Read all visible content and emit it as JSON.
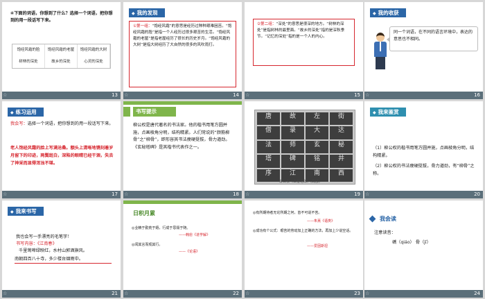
{
  "slides": [
    {
      "num": "13",
      "question": "④下面的词语，你想到了什么？选择一个词语，把你想到的用一段话写下来。",
      "words": [
        "饱经风霜的脸",
        "树林的深处",
        "饱经风霜的老屋",
        "故乡的深处",
        "饱经风霜的大树",
        "心灵的深处"
      ]
    },
    {
      "num": "14",
      "title": "我的发现",
      "lead": "①第一组：",
      "body": "“饱经风霜”的意思是经历过种种艰难困苦。“饱经风霜的脸”是指一个人经历过很多艰苦的生活。“饱经风霜的老屋”是指老屋经历了很长的历史岁月。“饱经风霜的大树”是指大树经历了大自然的很多的风吹雨打。"
    },
    {
      "num": "15",
      "lead": "②第二组：",
      "body": "“深处”的意思是很深的地方。“树林的深处”是指树林的最里面。“故乡的深处”指的是深秋季节。“记忆的深处”指的是一个人的内心。"
    },
    {
      "num": "16",
      "title": "我的收获",
      "callout": "同一个词语，在不同的语言环境中，表达的意思也不相同。"
    },
    {
      "num": "17",
      "title": "练习运用",
      "lead": "我会写：",
      "prompt": "选择一个词语，把你想到的用一段话写下来。",
      "answer": "老人饱经风霜的脸上写满沧桑。额头上清晰地镌刻着岁月留下的印迹，两鬓斑白，深陷的眼睛已经干涸，失去了神采而显得浑浊不堪。"
    },
    {
      "num": "18",
      "title": "书写提示",
      "body": "柳公权是唐代著名的书法家。他的楷书用笔方圆并施，点画棱角分明，结构精紧。人们常说的“颜筋柳骨”之“柳骨”，即形容其书法瘦硬挺拔，骨力遒劲。《玄秘塔碑》是其楷书代表作之一。"
    },
    {
      "num": "19",
      "rubbing_chars": [
        "唐",
        "故",
        "左",
        "街",
        "僧",
        "录",
        "大",
        "达",
        "法",
        "师",
        "玄",
        "秘",
        "塔",
        "碑",
        "铭",
        "并",
        "序",
        "江",
        "南",
        "西"
      ],
      "caption": "柳公权《玄秘塔碑》(局部)"
    },
    {
      "num": "20",
      "title": "我来鉴赏",
      "points": [
        "（1）柳公权的楷书用笔方圆并施，点画棱角分明，结构精紧。",
        "（2）柳公权的书法瘦硬挺拔，骨力遒劲，有“柳骨”之称。"
      ]
    },
    {
      "num": "21",
      "title": "我来书写",
      "intro": "我也会写一手漂亮的毛笔字！",
      "label": "书写内容：《江南春》",
      "lines": [
        "千里莺啼绿映红，水村山郭酒旗风。",
        "南朝四百八十寺，多少楼台烟雨中。"
      ]
    },
    {
      "num": "22",
      "title": "日积月累",
      "items": [
        {
          "text": "◎业精于勤荒于嬉，行成于思毁于随。",
          "source": "——韩愈《进学解》"
        },
        {
          "text": "◎闻其言而观其行。",
          "source": "——《论语》"
        }
      ]
    },
    {
      "num": "23",
      "items": [
        {
          "text": "◎有所期待者无论所期之何，皆不可说不苦。",
          "source": "——朱熹《语类》"
        },
        {
          "text": "◎成功有个公式：艰苦的劳动加上正确的方法，再加上少说空话。",
          "source": "——爱因斯坦"
        }
      ]
    },
    {
      "num": "24",
      "title": "我会读",
      "label": "注意读音：",
      "pinyin": "嶠（qiáo）  骨（jī）"
    }
  ]
}
